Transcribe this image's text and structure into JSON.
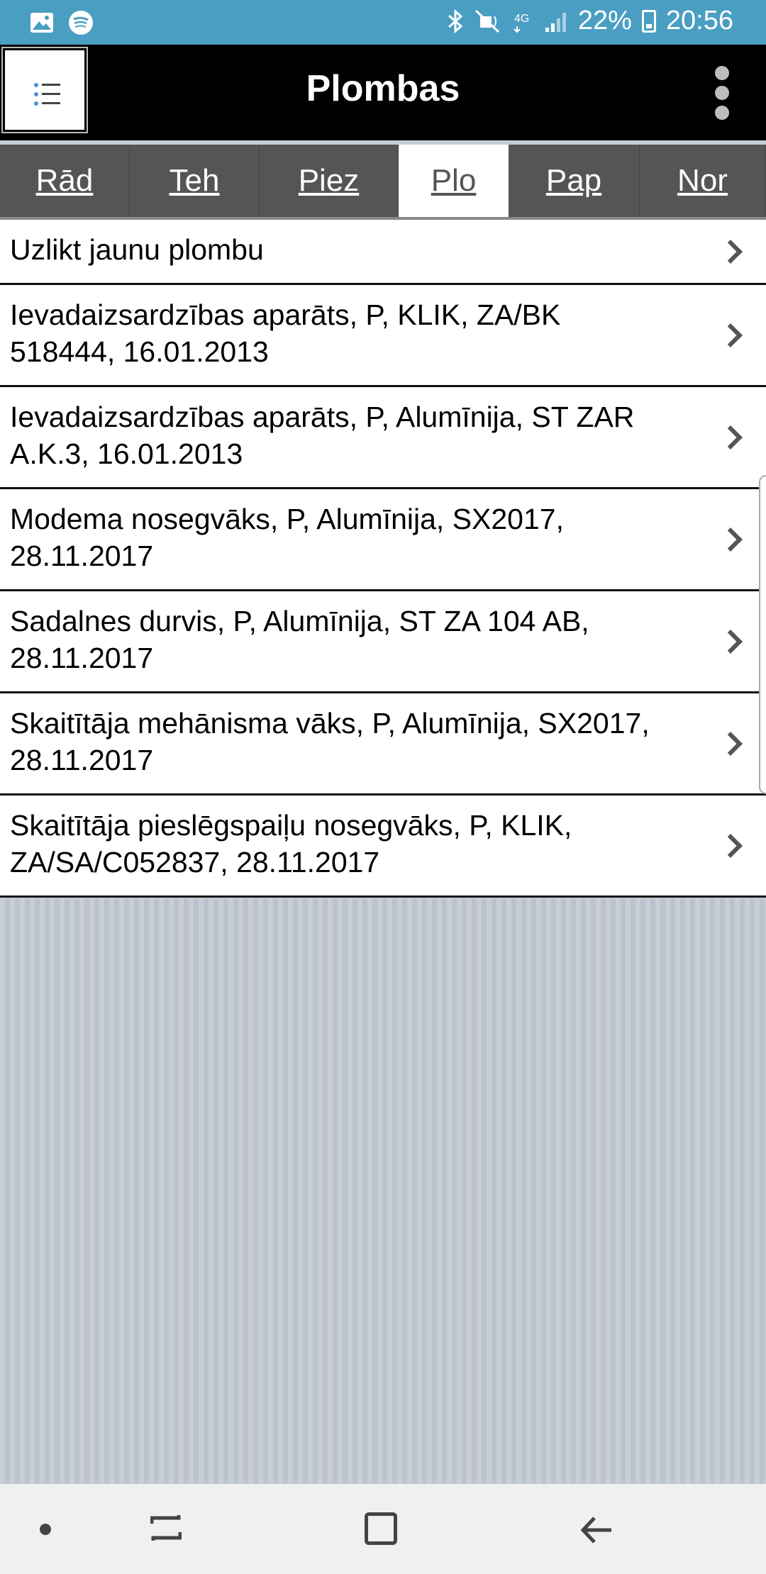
{
  "status_bar": {
    "icons_left": [
      "gallery-icon",
      "spotify-icon"
    ],
    "icons_right": [
      "bluetooth-icon",
      "mute-icon",
      "4g-icon",
      "signal-icon"
    ],
    "battery": "22%",
    "time": "20:56"
  },
  "header": {
    "title": "Plombas",
    "menu_icon": "list-icon",
    "overflow_icon": "more-vertical-icon"
  },
  "tabs": [
    {
      "label": "Rād",
      "active": false
    },
    {
      "label": "Teh",
      "active": false
    },
    {
      "label": "Piez",
      "active": false
    },
    {
      "label": "Plo",
      "active": true
    },
    {
      "label": "Pap",
      "active": false
    },
    {
      "label": "Nor",
      "active": false
    }
  ],
  "list": {
    "items": [
      {
        "line1": "Uzlikt jaunu plombu",
        "line2": ""
      },
      {
        "line1": "Ievadaizsardzības aparāts, P, KLIK, ZA/BK",
        "line2": "518444, 16.01.2013"
      },
      {
        "line1": "Ievadaizsardzības aparāts, P, Alumīnija, ST ZAR",
        "line2": "A.K.3, 16.01.2013"
      },
      {
        "line1": "Modema nosegvāks, P, Alumīnija, SX2017,",
        "line2": "28.11.2017"
      },
      {
        "line1": "Sadalnes durvis, P, Alumīnija, ST ZA 104 AB,",
        "line2": "28.11.2017"
      },
      {
        "line1": "Skaitītāja mehānisma vāks, P, Alumīnija, SX2017,",
        "line2": "28.11.2017"
      },
      {
        "line1": "Skaitītāja pieslēgspaiļu nosegvāks, P, KLIK,",
        "line2": "ZA/SA/C052837, 28.11.2017"
      }
    ]
  },
  "nav_bar": {
    "icons": [
      "dot-icon",
      "recent-apps-icon",
      "home-icon",
      "back-icon"
    ]
  }
}
